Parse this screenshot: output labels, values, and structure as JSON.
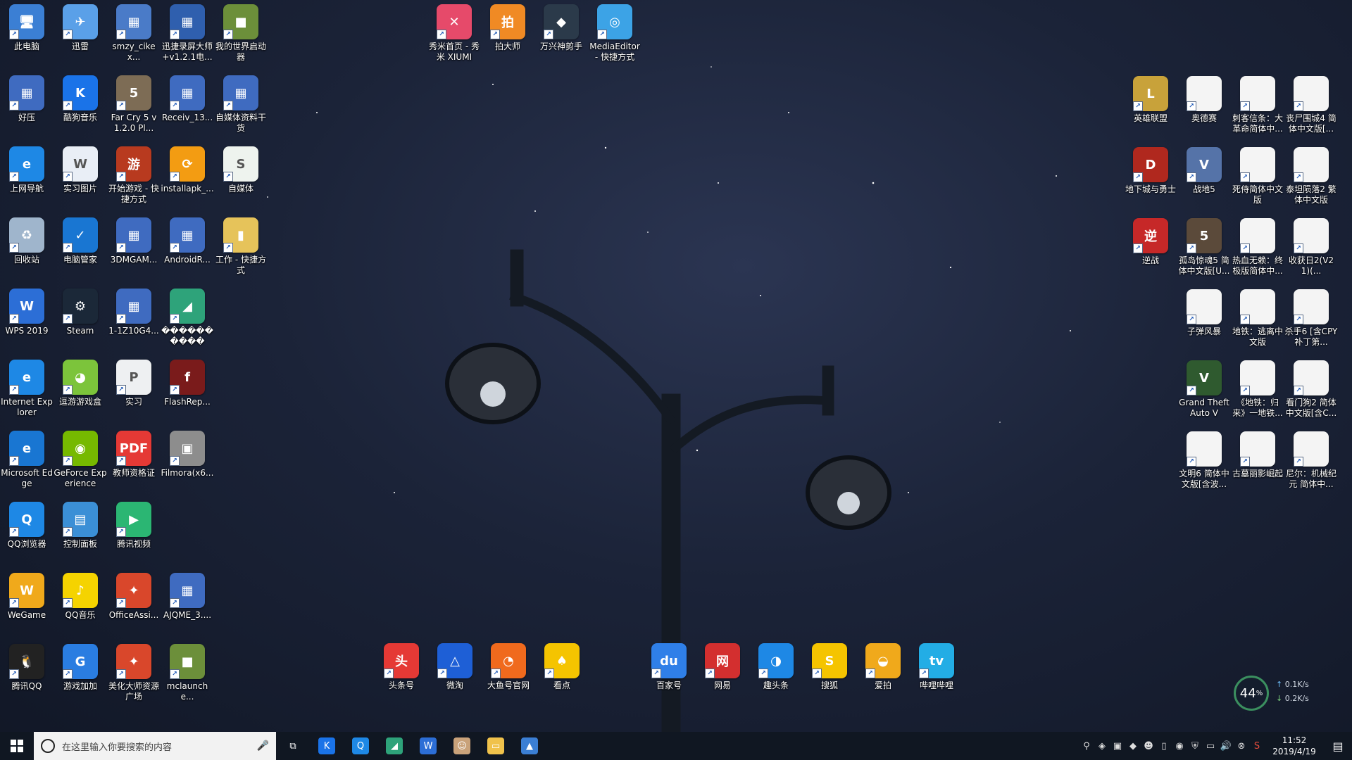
{
  "left_icons": [
    {
      "label": "此电脑",
      "color": "#3b7fd4",
      "glyph": "🖥"
    },
    {
      "label": "迅雷",
      "color": "#5aa0e8",
      "glyph": "✈"
    },
    {
      "label": "smzy_cikex...",
      "color": "#4a7bc8",
      "glyph": "▦"
    },
    {
      "label": "迅捷录屏大师+v1.2.1电...",
      "color": "#2f5fae",
      "glyph": "▦"
    },
    {
      "label": "我的世界启动器",
      "color": "#6c8f3a",
      "glyph": "■"
    },
    {
      "label": "好压",
      "color": "#3f6bc0",
      "glyph": "▦"
    },
    {
      "label": "酷狗音乐",
      "color": "#1a73e8",
      "glyph": "K"
    },
    {
      "label": "Far Cry 5 v1.2.0 Pl...",
      "color": "#7d6c55",
      "glyph": "5"
    },
    {
      "label": "Receiv_13...",
      "color": "#3f6bc0",
      "glyph": "▦"
    },
    {
      "label": "自媒体资料干货",
      "color": "#3f6bc0",
      "glyph": "▦"
    },
    {
      "label": "上网导航",
      "color": "#1e88e5",
      "glyph": "e"
    },
    {
      "label": "实习图片",
      "color": "#e9eef6",
      "glyph": "W"
    },
    {
      "label": "开始游戏 - 快捷方式",
      "color": "#b83a1f",
      "glyph": "游"
    },
    {
      "label": "installapk_...",
      "color": "#f39c12",
      "glyph": "⟳"
    },
    {
      "label": "自媒体",
      "color": "#eef3ee",
      "glyph": "S"
    },
    {
      "label": "回收站",
      "color": "#9fb5cc",
      "glyph": "♻"
    },
    {
      "label": "电脑管家",
      "color": "#1976d2",
      "glyph": "✓"
    },
    {
      "label": "3DMGAM...",
      "color": "#3f6bc0",
      "glyph": "▦"
    },
    {
      "label": "AndroidR...",
      "color": "#3f6bc0",
      "glyph": "▦"
    },
    {
      "label": "工作 - 快捷方式",
      "color": "#e6c35a",
      "glyph": "▮"
    },
    {
      "label": "WPS 2019",
      "color": "#2c6ed6",
      "glyph": "W"
    },
    {
      "label": "Steam",
      "color": "#1b2838",
      "glyph": "⚙"
    },
    {
      "label": "1-1Z10G4...",
      "color": "#3f6bc0",
      "glyph": "▦"
    },
    {
      "label": "����������",
      "color": "#2ea37a",
      "glyph": "◢"
    },
    {
      "label": "",
      "color": "",
      "glyph": ""
    },
    {
      "label": "Internet Explorer",
      "color": "#1e88e5",
      "glyph": "e"
    },
    {
      "label": "逗游游戏盒",
      "color": "#7cc43b",
      "glyph": "◕"
    },
    {
      "label": "实习",
      "color": "#eef0f2",
      "glyph": "P"
    },
    {
      "label": "FlashRep...",
      "color": "#7a1b1b",
      "glyph": "f"
    },
    {
      "label": "",
      "color": "",
      "glyph": ""
    },
    {
      "label": "Microsoft Edge",
      "color": "#1976d2",
      "glyph": "e"
    },
    {
      "label": "GeForce Experience",
      "color": "#76b900",
      "glyph": "◉"
    },
    {
      "label": "教师资格证",
      "color": "#e53935",
      "glyph": "PDF"
    },
    {
      "label": "Filmora(x6...",
      "color": "#8d8d8d",
      "glyph": "▣"
    },
    {
      "label": "",
      "color": "",
      "glyph": ""
    },
    {
      "label": "QQ浏览器",
      "color": "#1e88e5",
      "glyph": "Q"
    },
    {
      "label": "控制面板",
      "color": "#3b8fd6",
      "glyph": "▤"
    },
    {
      "label": "腾讯视频",
      "color": "#2bb673",
      "glyph": "▶"
    },
    {
      "label": "",
      "color": "",
      "glyph": ""
    },
    {
      "label": "",
      "color": "",
      "glyph": ""
    },
    {
      "label": "WeGame",
      "color": "#f0a91b",
      "glyph": "W"
    },
    {
      "label": "QQ音乐",
      "color": "#f5d300",
      "glyph": "♪"
    },
    {
      "label": "OfficeAssi...",
      "color": "#d9472b",
      "glyph": "✦"
    },
    {
      "label": "AJQME_3....",
      "color": "#3f6bc0",
      "glyph": "▦"
    },
    {
      "label": "",
      "color": "",
      "glyph": ""
    },
    {
      "label": "腾讯QQ",
      "color": "#222",
      "glyph": "🐧"
    },
    {
      "label": "游戏加加",
      "color": "#2a7de1",
      "glyph": "G"
    },
    {
      "label": "美化大师资源广场",
      "color": "#d9472b",
      "glyph": "✦"
    },
    {
      "label": "mclaunche...",
      "color": "#6c8f3a",
      "glyph": "■"
    },
    {
      "label": "",
      "color": "",
      "glyph": ""
    }
  ],
  "top_icons": [
    {
      "label": "秀米首页 - 秀米 XIUMI",
      "color": "#e64a6a",
      "glyph": "✕"
    },
    {
      "label": "拍大师",
      "color": "#f08a24",
      "glyph": "拍"
    },
    {
      "label": "万兴神剪手",
      "color": "#2b3a4a",
      "glyph": "◆"
    },
    {
      "label": "MediaEditor - 快捷方式",
      "color": "#3ca3e6",
      "glyph": "◎"
    }
  ],
  "bottom_icons_a": [
    {
      "label": "头条号",
      "color": "#e53935",
      "glyph": "头"
    },
    {
      "label": "微淘",
      "color": "#1e5fd6",
      "glyph": "△"
    },
    {
      "label": "大鱼号官网",
      "color": "#f06a1d",
      "glyph": "◔"
    },
    {
      "label": "看点",
      "color": "#f5c400",
      "glyph": "♠"
    }
  ],
  "bottom_icons_b": [
    {
      "label": "百家号",
      "color": "#2f7fe8",
      "glyph": "du"
    },
    {
      "label": "网易",
      "color": "#d32f2f",
      "glyph": "网"
    },
    {
      "label": "趣头条",
      "color": "#1e88e5",
      "glyph": "◑"
    },
    {
      "label": "搜狐",
      "color": "#f5c400",
      "glyph": "S"
    },
    {
      "label": "爱拍",
      "color": "#f0a91b",
      "glyph": "◒"
    },
    {
      "label": "哔哩哔哩",
      "color": "#23ade5",
      "glyph": "tv"
    }
  ],
  "right_icons": [
    {
      "label": "英雄联盟",
      "color": "#c8a23a",
      "glyph": "L"
    },
    {
      "label": "奥德赛",
      "color": "#f4f4f4",
      "glyph": ""
    },
    {
      "label": "刺客信条：大革命简体中...",
      "color": "#f4f4f4",
      "glyph": ""
    },
    {
      "label": "丧尸围城4 简体中文版[...",
      "color": "#f4f4f4",
      "glyph": ""
    },
    {
      "label": "地下城与勇士",
      "color": "#b0281e",
      "glyph": "D"
    },
    {
      "label": "战地5",
      "color": "#5573a8",
      "glyph": "V"
    },
    {
      "label": "死侍简体中文版",
      "color": "#f4f4f4",
      "glyph": ""
    },
    {
      "label": "泰坦陨落2 繁体中文版",
      "color": "#f4f4f4",
      "glyph": ""
    },
    {
      "label": "逆战",
      "color": "#c62828",
      "glyph": "逆"
    },
    {
      "label": "孤岛惊魂5 简体中文版[U...",
      "color": "#5b4a3a",
      "glyph": "5"
    },
    {
      "label": "热血无赖：终极版简体中...",
      "color": "#f4f4f4",
      "glyph": ""
    },
    {
      "label": "收获日2(V21)(...",
      "color": "#f4f4f4",
      "glyph": ""
    },
    {
      "label": "",
      "color": "",
      "glyph": ""
    },
    {
      "label": "子弹风暴",
      "color": "#f4f4f4",
      "glyph": ""
    },
    {
      "label": "地铁：逃离中文版",
      "color": "#f4f4f4",
      "glyph": ""
    },
    {
      "label": "杀手6 [含CPY补丁第...",
      "color": "#f4f4f4",
      "glyph": ""
    },
    {
      "label": "",
      "color": "",
      "glyph": ""
    },
    {
      "label": "Grand Theft Auto V",
      "color": "#2f5a2f",
      "glyph": "V"
    },
    {
      "label": "《地铁：归来》一地铁...",
      "color": "#f4f4f4",
      "glyph": ""
    },
    {
      "label": "看门狗2 简体中文版[含C...",
      "color": "#f4f4f4",
      "glyph": ""
    },
    {
      "label": "",
      "color": "",
      "glyph": ""
    },
    {
      "label": "文明6 简体中文版[含波...",
      "color": "#f4f4f4",
      "glyph": ""
    },
    {
      "label": "古墓丽影崛起",
      "color": "#f4f4f4",
      "glyph": ""
    },
    {
      "label": "尼尔：机械纪元 简体中...",
      "color": "#f4f4f4",
      "glyph": ""
    }
  ],
  "taskbar": {
    "search_placeholder": "在这里输入你要搜索的内容",
    "time": "11:52",
    "date": "2019/4/19",
    "apps": [
      {
        "name": "task-view",
        "color": "transparent",
        "glyph": "⧉"
      },
      {
        "name": "kugou",
        "color": "#1a73e8",
        "glyph": "K"
      },
      {
        "name": "qq-browser",
        "color": "#1e88e5",
        "glyph": "Q"
      },
      {
        "name": "app-green",
        "color": "#2ea37a",
        "glyph": "◢"
      },
      {
        "name": "wps",
        "color": "#2c6ed6",
        "glyph": "W"
      },
      {
        "name": "avatar-app",
        "color": "#c9a27a",
        "glyph": "☺"
      },
      {
        "name": "file-explorer",
        "color": "#f0c24b",
        "glyph": "▭"
      },
      {
        "name": "photos",
        "color": "#3b7fd4",
        "glyph": "▲"
      }
    ]
  },
  "netmon": {
    "percent": "44",
    "unit": "%",
    "up": "0.1K/s",
    "down": "0.2K/s"
  }
}
